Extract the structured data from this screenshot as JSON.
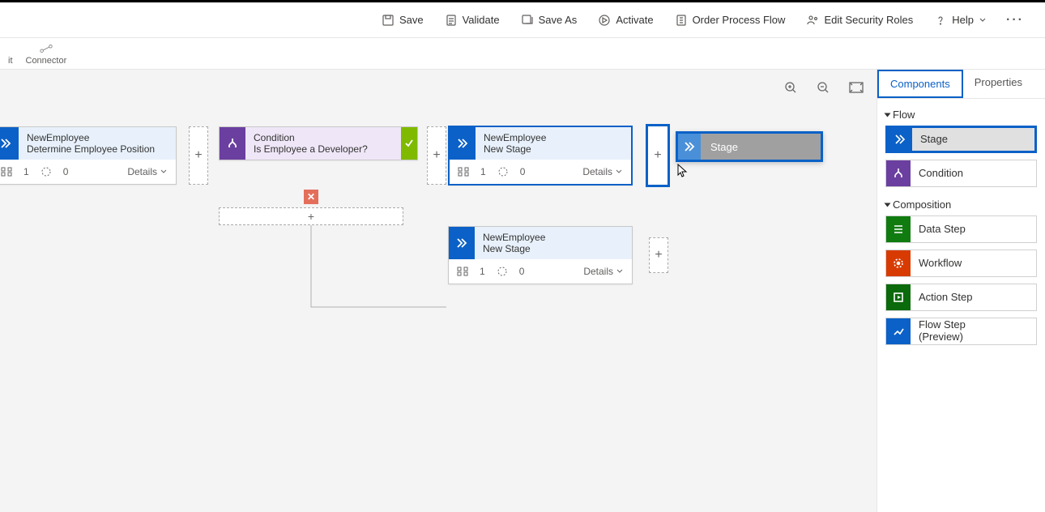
{
  "commands": {
    "save": "Save",
    "validate": "Validate",
    "save_as": "Save As",
    "activate": "Activate",
    "order": "Order Process Flow",
    "roles": "Edit Security Roles",
    "help": "Help"
  },
  "ribbon": {
    "cut_suffix": "it",
    "connector": "Connector"
  },
  "stages": {
    "s1": {
      "entity": "NewEmployee",
      "name": "Determine Employee Position",
      "steps": "1",
      "req": "0",
      "details": "Details"
    },
    "cond": {
      "title": "Condition",
      "question": "Is Employee a Developer?"
    },
    "s2": {
      "entity": "NewEmployee",
      "name": "New Stage",
      "steps": "1",
      "req": "0",
      "details": "Details"
    },
    "s3": {
      "entity": "NewEmployee",
      "name": "New Stage",
      "steps": "1",
      "req": "0",
      "details": "Details"
    }
  },
  "drag": {
    "label": "Stage"
  },
  "panel": {
    "tabs": {
      "components": "Components",
      "properties": "Properties"
    },
    "sections": {
      "flow": "Flow",
      "composition": "Composition"
    },
    "items": {
      "stage": "Stage",
      "condition": "Condition",
      "data_step": "Data Step",
      "workflow": "Workflow",
      "action_step": "Action Step",
      "flow_step": "Flow Step\n(Preview)"
    }
  }
}
